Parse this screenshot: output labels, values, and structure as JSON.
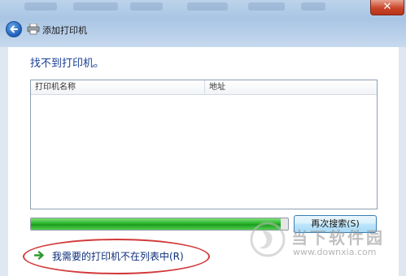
{
  "window": {
    "title": "添加打印机",
    "close_glyph": "✕"
  },
  "content": {
    "heading": "找不到打印机。",
    "list_columns": [
      "打印机名称",
      "地址"
    ]
  },
  "progress": {
    "value_fraction": 0.97
  },
  "buttons": {
    "search_again": "再次搜索(S)"
  },
  "link": {
    "not_listed": "我需要的打印机不在列表中(R)"
  },
  "watermark": {
    "text": "当下软件园",
    "url": "www.downxia.com"
  },
  "colors": {
    "heading": "#1b3f95",
    "progress": "#2cb52c",
    "annotation": "#d23a3a"
  }
}
